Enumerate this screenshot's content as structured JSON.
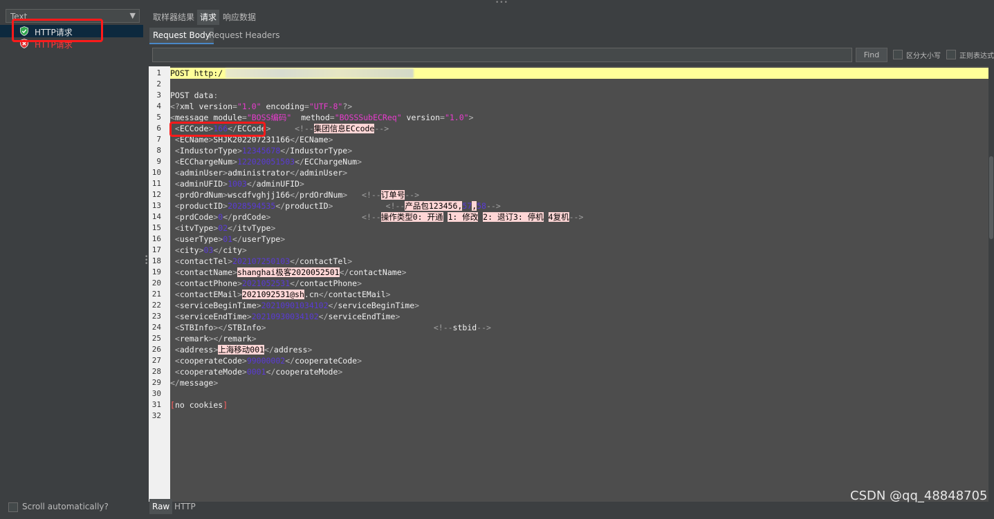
{
  "left_panel": {
    "renderer_select": "Text",
    "tree": [
      {
        "label": "HTTP请求",
        "status": "success"
      },
      {
        "label": "HTTP请求",
        "status": "error"
      }
    ],
    "scroll_automatically": "Scroll automatically?"
  },
  "tabs": [
    "取样器结果",
    "请求",
    "响应数据"
  ],
  "subtabs": [
    "Request Body",
    "Request Headers"
  ],
  "search": {
    "find_label": "Find",
    "case_sensitive": "区分大小写",
    "regex": "正则表达式"
  },
  "code_lines": [
    [
      {
        "t": "POST http:/"
      }
    ],
    [
      {
        "t": ""
      }
    ],
    [
      {
        "t": "POST data"
      },
      {
        "t": ":",
        "c": "tg"
      }
    ],
    [
      {
        "t": "<?",
        "c": "tg"
      },
      {
        "t": "xml version"
      },
      {
        "t": "=",
        "c": "tg"
      },
      {
        "t": "\"1.0\"",
        "c": "av"
      },
      {
        "t": " encoding"
      },
      {
        "t": "=",
        "c": "tg"
      },
      {
        "t": "\"UTF-8\"",
        "c": "av"
      },
      {
        "t": "?>",
        "c": "tg"
      }
    ],
    [
      {
        "t": "<",
        "c": "tg"
      },
      {
        "t": "message module"
      },
      {
        "t": "=",
        "c": "tg"
      },
      {
        "t": "\"BOSS编码\"",
        "c": "av"
      },
      {
        "t": "  method"
      },
      {
        "t": "=",
        "c": "tg"
      },
      {
        "t": "\"BOSSSubECReq\"",
        "c": "av"
      },
      {
        "t": " version"
      },
      {
        "t": "=",
        "c": "tg"
      },
      {
        "t": "\"1.0\"",
        "c": "av"
      },
      {
        "t": ">",
        "c": "tg"
      }
    ],
    [
      {
        "t": " <",
        "c": "tg"
      },
      {
        "t": "ECCode"
      },
      {
        "t": ">",
        "c": "tg"
      },
      {
        "t": "166",
        "c": "nv"
      },
      {
        "t": "</",
        "c": "tg"
      },
      {
        "t": "ECCode"
      },
      {
        "t": ">",
        "c": "tg"
      },
      {
        "t": "     "
      },
      {
        "t": "<!--",
        "c": "cm"
      },
      {
        "t": "集团信息ECcode",
        "c": "pk"
      },
      {
        "t": "-->",
        "c": "cm"
      }
    ],
    [
      {
        "t": " <",
        "c": "tg"
      },
      {
        "t": "ECName"
      },
      {
        "t": ">",
        "c": "tg"
      },
      {
        "t": "SHJK202207231166"
      },
      {
        "t": "</",
        "c": "tg"
      },
      {
        "t": "ECName"
      },
      {
        "t": ">",
        "c": "tg"
      }
    ],
    [
      {
        "t": " <",
        "c": "tg"
      },
      {
        "t": "IndustorType"
      },
      {
        "t": ">",
        "c": "tg"
      },
      {
        "t": "12345678",
        "c": "nv"
      },
      {
        "t": "</",
        "c": "tg"
      },
      {
        "t": "IndustorType"
      },
      {
        "t": ">",
        "c": "tg"
      }
    ],
    [
      {
        "t": " <",
        "c": "tg"
      },
      {
        "t": "ECChargeNum"
      },
      {
        "t": ">",
        "c": "tg"
      },
      {
        "t": "122020051503",
        "c": "nv"
      },
      {
        "t": "</",
        "c": "tg"
      },
      {
        "t": "ECChargeNum"
      },
      {
        "t": ">",
        "c": "tg"
      }
    ],
    [
      {
        "t": " <",
        "c": "tg"
      },
      {
        "t": "adminUser"
      },
      {
        "t": ">",
        "c": "tg"
      },
      {
        "t": "administrator"
      },
      {
        "t": "</",
        "c": "tg"
      },
      {
        "t": "adminUser"
      },
      {
        "t": ">",
        "c": "tg"
      }
    ],
    [
      {
        "t": " <",
        "c": "tg"
      },
      {
        "t": "adminUFID"
      },
      {
        "t": ">",
        "c": "tg"
      },
      {
        "t": "1003",
        "c": "nv"
      },
      {
        "t": "</",
        "c": "tg"
      },
      {
        "t": "adminUFID"
      },
      {
        "t": ">",
        "c": "tg"
      }
    ],
    [
      {
        "t": " <",
        "c": "tg"
      },
      {
        "t": "prdOrdNum"
      },
      {
        "t": ">",
        "c": "tg"
      },
      {
        "t": "wscdfvghjj166"
      },
      {
        "t": "</",
        "c": "tg"
      },
      {
        "t": "prdOrdNum"
      },
      {
        "t": ">",
        "c": "tg"
      },
      {
        "t": "   "
      },
      {
        "t": "<!--",
        "c": "cm"
      },
      {
        "t": "订单号",
        "c": "pk"
      },
      {
        "t": "-->",
        "c": "cm"
      }
    ],
    [
      {
        "t": " <",
        "c": "tg"
      },
      {
        "t": "productID"
      },
      {
        "t": ">",
        "c": "tg"
      },
      {
        "t": "2028594535",
        "c": "nv"
      },
      {
        "t": "</",
        "c": "tg"
      },
      {
        "t": "productID"
      },
      {
        "t": ">",
        "c": "tg"
      },
      {
        "t": "           "
      },
      {
        "t": "<!--",
        "c": "cm"
      },
      {
        "t": "产品包123456",
        "c": "pk"
      },
      {
        "t": ",",
        "c": "pk"
      },
      {
        "t": "57",
        "c": "nv"
      },
      {
        "t": ",",
        "c": "pk"
      },
      {
        "t": "58",
        "c": "nv"
      },
      {
        "t": "-->",
        "c": "cm"
      }
    ],
    [
      {
        "t": " <",
        "c": "tg"
      },
      {
        "t": "prdCode"
      },
      {
        "t": ">",
        "c": "tg"
      },
      {
        "t": "0",
        "c": "nv"
      },
      {
        "t": "</",
        "c": "tg"
      },
      {
        "t": "prdCode"
      },
      {
        "t": ">",
        "c": "tg"
      },
      {
        "t": "                   "
      },
      {
        "t": "<!--",
        "c": "cm"
      },
      {
        "t": "操作类型0: 开通",
        "c": "pk"
      },
      {
        "t": " "
      },
      {
        "t": "1: 修改",
        "c": "pk"
      },
      {
        "t": " "
      },
      {
        "t": "2: 退订3: 停机",
        "c": "pk"
      },
      {
        "t": " "
      },
      {
        "t": "4复机",
        "c": "pk"
      },
      {
        "t": "-->",
        "c": "cm"
      }
    ],
    [
      {
        "t": " <",
        "c": "tg"
      },
      {
        "t": "itvType"
      },
      {
        "t": ">",
        "c": "tg"
      },
      {
        "t": "02",
        "c": "nv"
      },
      {
        "t": "</",
        "c": "tg"
      },
      {
        "t": "itvType"
      },
      {
        "t": ">",
        "c": "tg"
      }
    ],
    [
      {
        "t": " <",
        "c": "tg"
      },
      {
        "t": "userType"
      },
      {
        "t": ">",
        "c": "tg"
      },
      {
        "t": "01",
        "c": "nv"
      },
      {
        "t": "</",
        "c": "tg"
      },
      {
        "t": "userType"
      },
      {
        "t": ">",
        "c": "tg"
      }
    ],
    [
      {
        "t": " <",
        "c": "tg"
      },
      {
        "t": "city"
      },
      {
        "t": ">",
        "c": "tg"
      },
      {
        "t": "03",
        "c": "nv"
      },
      {
        "t": "</",
        "c": "tg"
      },
      {
        "t": "city"
      },
      {
        "t": ">",
        "c": "tg"
      }
    ],
    [
      {
        "t": " <",
        "c": "tg"
      },
      {
        "t": "contactTel"
      },
      {
        "t": ">",
        "c": "tg"
      },
      {
        "t": "202107250103",
        "c": "nv"
      },
      {
        "t": "</",
        "c": "tg"
      },
      {
        "t": "contactTel"
      },
      {
        "t": ">",
        "c": "tg"
      }
    ],
    [
      {
        "t": " <",
        "c": "tg"
      },
      {
        "t": "contactName"
      },
      {
        "t": ">",
        "c": "tg"
      },
      {
        "t": "shanghai极客2020052501",
        "c": "pk"
      },
      {
        "t": "</",
        "c": "tg"
      },
      {
        "t": "contactName"
      },
      {
        "t": ">",
        "c": "tg"
      }
    ],
    [
      {
        "t": " <",
        "c": "tg"
      },
      {
        "t": "contactPhone"
      },
      {
        "t": ">",
        "c": "tg"
      },
      {
        "t": "2021052531",
        "c": "nv"
      },
      {
        "t": "</",
        "c": "tg"
      },
      {
        "t": "contactPhone"
      },
      {
        "t": ">",
        "c": "tg"
      }
    ],
    [
      {
        "t": " <",
        "c": "tg"
      },
      {
        "t": "contactEMail"
      },
      {
        "t": ">",
        "c": "tg"
      },
      {
        "t": "2021092531@sh",
        "c": "pk"
      },
      {
        "t": ".cn"
      },
      {
        "t": "</",
        "c": "tg"
      },
      {
        "t": "contactEMail"
      },
      {
        "t": ">",
        "c": "tg"
      }
    ],
    [
      {
        "t": " <",
        "c": "tg"
      },
      {
        "t": "serviceBeginTime"
      },
      {
        "t": ">",
        "c": "tg"
      },
      {
        "t": "20210901034102",
        "c": "nv"
      },
      {
        "t": "</",
        "c": "tg"
      },
      {
        "t": "serviceBeginTime"
      },
      {
        "t": ">",
        "c": "tg"
      }
    ],
    [
      {
        "t": " <",
        "c": "tg"
      },
      {
        "t": "serviceEndTime"
      },
      {
        "t": ">",
        "c": "tg"
      },
      {
        "t": "20210930034102",
        "c": "nv"
      },
      {
        "t": "</",
        "c": "tg"
      },
      {
        "t": "serviceEndTime"
      },
      {
        "t": ">",
        "c": "tg"
      }
    ],
    [
      {
        "t": " <",
        "c": "tg"
      },
      {
        "t": "STBInfo"
      },
      {
        "t": "></",
        "c": "tg"
      },
      {
        "t": "STBInfo"
      },
      {
        "t": ">",
        "c": "tg"
      },
      {
        "t": "                                   "
      },
      {
        "t": "<!--",
        "c": "cm"
      },
      {
        "t": "stbid"
      },
      {
        "t": "-->",
        "c": "cm"
      }
    ],
    [
      {
        "t": " <",
        "c": "tg"
      },
      {
        "t": "remark"
      },
      {
        "t": "></",
        "c": "tg"
      },
      {
        "t": "remark"
      },
      {
        "t": ">",
        "c": "tg"
      }
    ],
    [
      {
        "t": " <",
        "c": "tg"
      },
      {
        "t": "address"
      },
      {
        "t": ">",
        "c": "tg"
      },
      {
        "t": "上海移动001",
        "c": "pk"
      },
      {
        "t": "</",
        "c": "tg"
      },
      {
        "t": "address"
      },
      {
        "t": ">",
        "c": "tg"
      }
    ],
    [
      {
        "t": " <",
        "c": "tg"
      },
      {
        "t": "cooperateCode"
      },
      {
        "t": ">",
        "c": "tg"
      },
      {
        "t": "99000002",
        "c": "nv"
      },
      {
        "t": "</",
        "c": "tg"
      },
      {
        "t": "cooperateCode"
      },
      {
        "t": ">",
        "c": "tg"
      }
    ],
    [
      {
        "t": " <",
        "c": "tg"
      },
      {
        "t": "cooperateMode"
      },
      {
        "t": ">",
        "c": "tg"
      },
      {
        "t": "0001",
        "c": "nv"
      },
      {
        "t": "</",
        "c": "tg"
      },
      {
        "t": "cooperateMode"
      },
      {
        "t": ">",
        "c": "tg"
      }
    ],
    [
      {
        "t": "</",
        "c": "tg"
      },
      {
        "t": "message"
      },
      {
        "t": ">",
        "c": "tg"
      }
    ],
    [
      {
        "t": ""
      }
    ],
    [
      {
        "t": "[",
        "c": "rd"
      },
      {
        "t": "no cookies"
      },
      {
        "t": "]",
        "c": "rd"
      }
    ],
    [
      {
        "t": ""
      }
    ]
  ],
  "bottom_tabs": [
    "Raw",
    "HTTP"
  ],
  "watermark": "CSDN @qq_48848705",
  "colors": {
    "background": "#3c3f41",
    "selected_row": "#0d293e",
    "highlight_line": "#ffff99",
    "annotation_red": "#ff1a1a",
    "success_green": "#2fa84f",
    "error_red": "#e03030"
  }
}
